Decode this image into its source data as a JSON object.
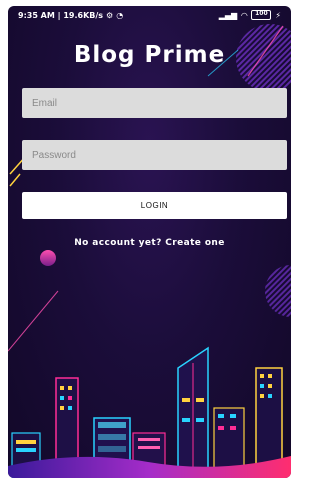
{
  "status_bar": {
    "time_speed": "9:35 AM | 19.6KB/s",
    "battery": "100"
  },
  "app": {
    "title": "Blog Prime"
  },
  "login_form": {
    "email_placeholder": "Email",
    "password_placeholder": "Password",
    "login_label": "LOGIN",
    "signup_prompt": "No account yet? Create one"
  },
  "colors": {
    "background": "#1b0d3a",
    "field": "#dcdcdc",
    "button": "#ffffff",
    "neon_pink": "#ff2d95",
    "neon_cyan": "#29d3ff",
    "neon_yellow": "#ffd23f"
  }
}
